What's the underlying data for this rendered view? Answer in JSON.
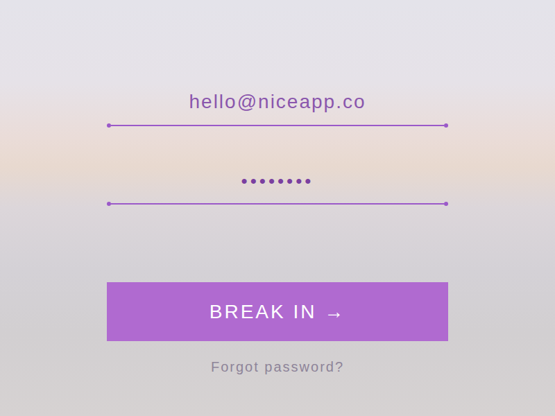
{
  "email_field": {
    "value": "hello@niceapp.co"
  },
  "password_field": {
    "value": "••••••••"
  },
  "submit_button": {
    "label": "BREAK IN →"
  },
  "forgot_link": {
    "label": "Forgot password?"
  }
}
